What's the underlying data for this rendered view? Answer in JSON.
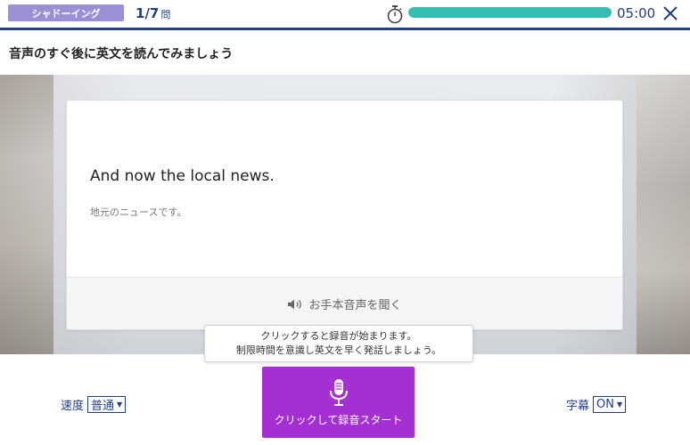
{
  "header": {
    "mode_label": "シャドーイング",
    "current": "1",
    "total": "/7",
    "unit": "問",
    "timer": "05:00",
    "timer_progress_pct": 100,
    "colors": {
      "accent": "#1f3f8a",
      "badge": "#9b8fd6",
      "timer_fill": "#36bdb2"
    }
  },
  "instruction": "音声のすぐ後に英文を読んでみましょう",
  "card": {
    "sentence_en": "And now the local news.",
    "sentence_jp": "地元のニュースです。",
    "listen_label": "お手本音声を聞く",
    "listen_icon": "speaker-icon"
  },
  "tooltip": {
    "line1": "クリックすると録音が始まります。",
    "line2": "制限時間を意識し英文を早く発話しましょう。"
  },
  "controls": {
    "speed_label": "速度",
    "speed_value": "普通",
    "subtitle_label": "字幕",
    "subtitle_value": "ON",
    "record_label": "クリックして録音スタート",
    "record_icon": "microphone-icon",
    "record_color": "#a42fd3"
  }
}
